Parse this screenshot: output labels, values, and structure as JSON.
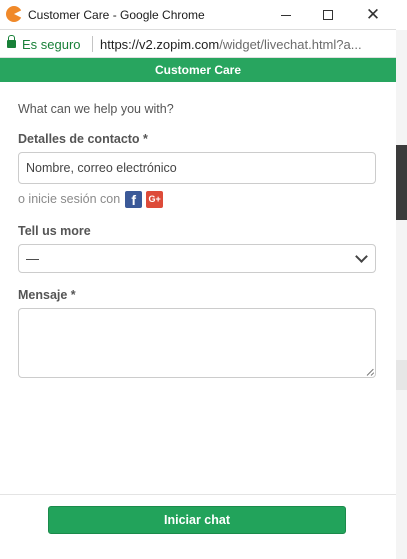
{
  "window": {
    "title": "Customer Care - Google Chrome",
    "minimize_glyph": "",
    "close_glyph": "✕"
  },
  "addressbar": {
    "secure_label": "Es seguro",
    "url_host": "https://v2.zopim.com",
    "url_rest": "/widget/livechat.html?a..."
  },
  "widget": {
    "header_title": "Customer Care",
    "help_text": "What can we help you with?",
    "contact": {
      "label": "Detalles de contacto *",
      "placeholder": "Nombre, correo electrónico",
      "login_text": "o inicie sesión con",
      "facebook_glyph": "f",
      "google_glyph": "G+"
    },
    "tell_us": {
      "label": "Tell us more",
      "selected": "—"
    },
    "message": {
      "label": "Mensaje *",
      "value": ""
    },
    "submit_label": "Iniciar chat"
  },
  "colors": {
    "brand_green": "#28a55f",
    "button_green": "#22a35b",
    "secure_green": "#188038",
    "facebook_blue": "#3b5998",
    "google_red": "#dd4b39"
  },
  "icons": [
    "app-icon",
    "lock-icon",
    "facebook-icon",
    "google-plus-icon",
    "chevron-down-icon",
    "resize-grip-icon"
  ]
}
